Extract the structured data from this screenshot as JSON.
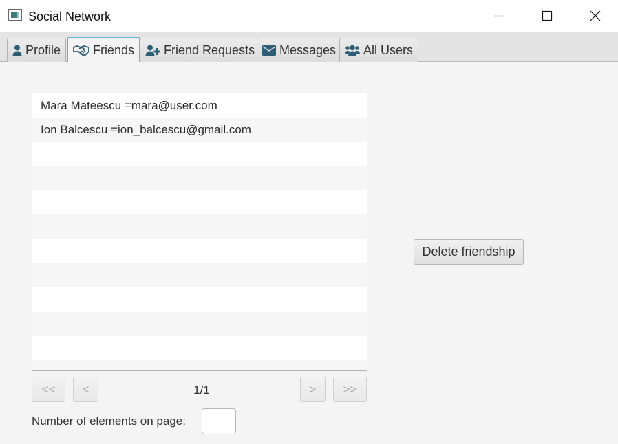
{
  "window": {
    "title": "Social Network"
  },
  "tabs": [
    {
      "label": "Profile",
      "icon": "user-icon",
      "selected": false
    },
    {
      "label": "Friends",
      "icon": "handshake-icon",
      "selected": true
    },
    {
      "label": "Friend Requests",
      "icon": "user-plus-icon",
      "selected": false
    },
    {
      "label": "Messages",
      "icon": "envelope-icon",
      "selected": false
    },
    {
      "label": "All Users",
      "icon": "users-icon",
      "selected": false
    }
  ],
  "friends_list": {
    "items": [
      "Mara Mateescu =mara@user.com",
      "Ion Balcescu =ion_balcescu@gmail.com"
    ]
  },
  "actions": {
    "delete_label": "Delete friendship"
  },
  "pagination": {
    "first_label": "<<",
    "prev_label": "<",
    "next_label": ">",
    "last_label": ">>",
    "page_text": "1/1",
    "per_page_label": "Number of elements on page:",
    "per_page_value": ""
  },
  "colors": {
    "icon_color": "#2e5e74",
    "selected_tab_border": "#5fb3d6"
  }
}
